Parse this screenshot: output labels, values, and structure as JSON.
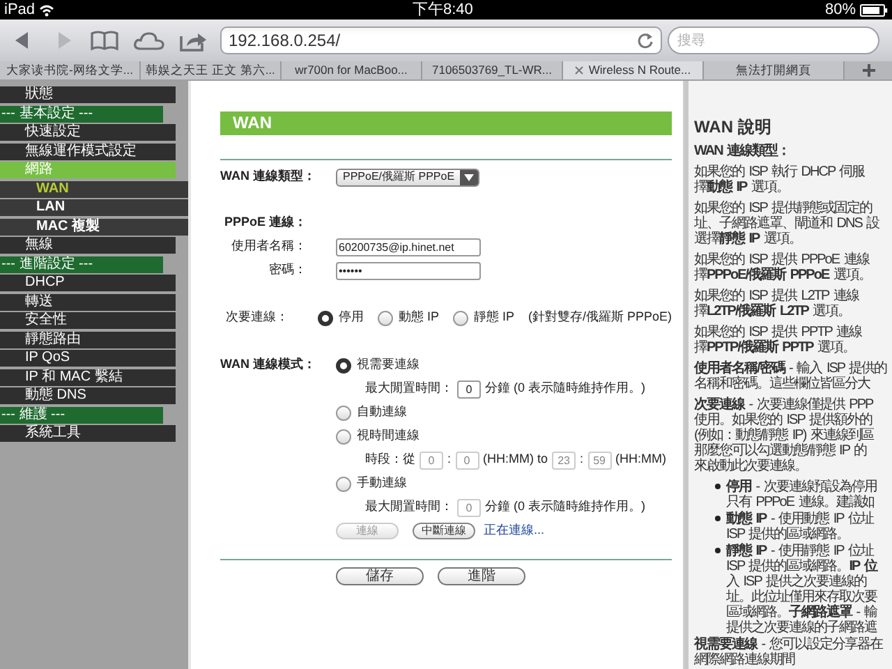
{
  "status_bar": {
    "device": "iPad",
    "time": "下午8:40",
    "battery": "80%"
  },
  "browser": {
    "back_enabled": true,
    "forward_enabled": false,
    "url": "192.168.0.254/",
    "search": {
      "placeholder": "搜尋"
    }
  },
  "tabs": [
    {
      "label": "大家读书院-网络文学...",
      "selected": false
    },
    {
      "label": "韩娱之天王 正文 第六...",
      "selected": false
    },
    {
      "label": "wr700n for MacBoo...",
      "selected": false
    },
    {
      "label": "7106503769_TL-WR...",
      "selected": false
    },
    {
      "label": "Wireless N Route...",
      "selected": true
    },
    {
      "label": "無法打開網頁",
      "selected": false
    }
  ],
  "sidebar": {
    "items": [
      {
        "kind": "item",
        "label": "狀態",
        "selected": false
      },
      {
        "kind": "header",
        "label": "--- 基本設定 ---"
      },
      {
        "kind": "item",
        "label": "快速設定",
        "selected": false
      },
      {
        "kind": "item",
        "label": "無線運作模式設定",
        "selected": false
      },
      {
        "kind": "item",
        "label": "網路",
        "selected": true,
        "children": [
          {
            "label": "WAN",
            "selected": true
          },
          {
            "label": "LAN",
            "selected": false
          },
          {
            "label": "MAC 複製",
            "selected": false
          }
        ]
      },
      {
        "kind": "item",
        "label": "無線",
        "selected": false
      },
      {
        "kind": "header",
        "label": "--- 進階設定 ---"
      },
      {
        "kind": "item",
        "label": "DHCP",
        "selected": false
      },
      {
        "kind": "item",
        "label": "轉送",
        "selected": false
      },
      {
        "kind": "item",
        "label": "安全性",
        "selected": false
      },
      {
        "kind": "item",
        "label": "靜態路由",
        "selected": false
      },
      {
        "kind": "item",
        "label": "IP QoS",
        "selected": false
      },
      {
        "kind": "item",
        "label": "IP 和 MAC 繫結",
        "selected": false
      },
      {
        "kind": "item",
        "label": "動態 DNS",
        "selected": false
      },
      {
        "kind": "header",
        "label": "--- 維護 ---"
      },
      {
        "kind": "item",
        "label": "系統工具",
        "selected": false
      }
    ]
  },
  "form": {
    "title": "WAN",
    "wan_type": {
      "label": "WAN 連線類型：",
      "value": "PPPoE/俄羅斯 PPPoE"
    },
    "pppoe_label": "PPPoE 連線：",
    "username": {
      "label": "使用者名稱：",
      "value": "60200735@ip.hinet.net"
    },
    "password": {
      "label": "密碼：",
      "value": "••••••"
    },
    "secondary": {
      "label": "次要連線：",
      "options": [
        {
          "label": "停用",
          "selected": true
        },
        {
          "label": "動態 IP",
          "selected": false
        },
        {
          "label": "靜態 IP",
          "selected": false
        }
      ],
      "note": "(針對雙存/俄羅斯 PPPoE)"
    },
    "mode": {
      "label": "WAN 連線模式：",
      "options": [
        {
          "label": "視需要連線",
          "selected": true,
          "detail": {
            "disabled": false,
            "parts": [
              {
                "kind": "text",
                "text": "最大閒置時間："
              },
              {
                "kind": "field",
                "value": "0"
              },
              {
                "kind": "text",
                "text": "分鐘 (0 表示隨時維持作用。)"
              }
            ]
          }
        },
        {
          "label": "自動連線",
          "selected": false
        },
        {
          "label": "視時間連線",
          "selected": false,
          "detail": {
            "disabled": true,
            "parts": [
              {
                "kind": "text",
                "text": "時段：從"
              },
              {
                "kind": "field",
                "value": "0"
              },
              {
                "kind": "text",
                "text": ":"
              },
              {
                "kind": "field",
                "value": "0"
              },
              {
                "kind": "text",
                "text": "(HH:MM) to"
              },
              {
                "kind": "field",
                "value": "23"
              },
              {
                "kind": "text",
                "text": ":"
              },
              {
                "kind": "field",
                "value": "59"
              },
              {
                "kind": "text",
                "text": "(HH:MM)"
              }
            ]
          }
        },
        {
          "label": "手動連線",
          "selected": false,
          "detail": {
            "disabled": true,
            "parts": [
              {
                "kind": "text",
                "text": "最大閒置時間："
              },
              {
                "kind": "field",
                "value": "0"
              },
              {
                "kind": "text",
                "text": "分鐘 (0 表示隨時維持作用。)"
              }
            ]
          }
        }
      ]
    },
    "actions": [
      {
        "label": "連線",
        "disabled": true
      },
      {
        "label": "中斷連線",
        "disabled": false
      }
    ],
    "connection_status": "正在連線...",
    "buttons": [
      "儲存",
      "進階"
    ]
  },
  "help": {
    "title": "WAN 說明",
    "blocks": [
      {
        "kind": "heading",
        "lines": [
          "WAN 連線類型："
        ]
      },
      {
        "kind": "para",
        "lines": [
          "如果您的 ISP 執行 DHCP 伺服",
          "擇**動態 IP** 選項。"
        ]
      },
      {
        "kind": "para",
        "lines": [
          "如果您的 ISP 提供靜態或固定的",
          "址、子網路遮罩、閘道和 DNS 設",
          "選擇**靜態 IP** 選項。"
        ]
      },
      {
        "kind": "para",
        "lines": [
          "如果您的 ISP 提供 PPPoE 連線",
          "擇**PPPoE/俄羅斯 PPPoE** 選項。"
        ]
      },
      {
        "kind": "para",
        "lines": [
          "如果您的 ISP 提供 L2TP 連線",
          "擇**L2TP/俄羅斯 L2TP** 選項。"
        ]
      },
      {
        "kind": "para",
        "lines": [
          "如果您的 ISP 提供 PPTP 連線",
          "擇**PPTP/俄羅斯 PPTP** 選項。"
        ]
      },
      {
        "kind": "para",
        "lines": [
          "**使用者名稱/密碼** - 輸入 ISP 提供的",
          "名稱和密碼。這些欄位皆區分大"
        ]
      },
      {
        "kind": "para",
        "lines": [
          "**次要連線** - 次要連線僅提供 PPP",
          "使用。如果您的 ISP 提供額外的",
          "(例如：動態/靜態 IP) 來連線到區",
          "那麼您可以勾選動態/靜態 IP 的",
          "來啟動此次要連線。"
        ]
      },
      {
        "kind": "bullet",
        "lines": [
          "**停用** - 次要連線預設為停用",
          "只有 PPPoE 連線。建議如"
        ]
      },
      {
        "kind": "bullet",
        "lines": [
          "**動態 IP** - 使用動態 IP 位址",
          "ISP 提供的區域網路。"
        ]
      },
      {
        "kind": "bullet",
        "lines": [
          "**靜態 IP** - 使用靜態 IP 位址",
          "ISP 提供的區域網路。**IP 位**",
          "入 ISP 提供之次要連線的",
          "址。此位址僅用來存取次要",
          "區域網路。**子網路遮罩** - 輸",
          "提供之次要連線的子網路遮"
        ]
      },
      {
        "kind": "para",
        "lines": [
          "**視需要連線** - 您可以設定分享器在",
          "網際網路連線期間"
        ]
      }
    ]
  }
}
